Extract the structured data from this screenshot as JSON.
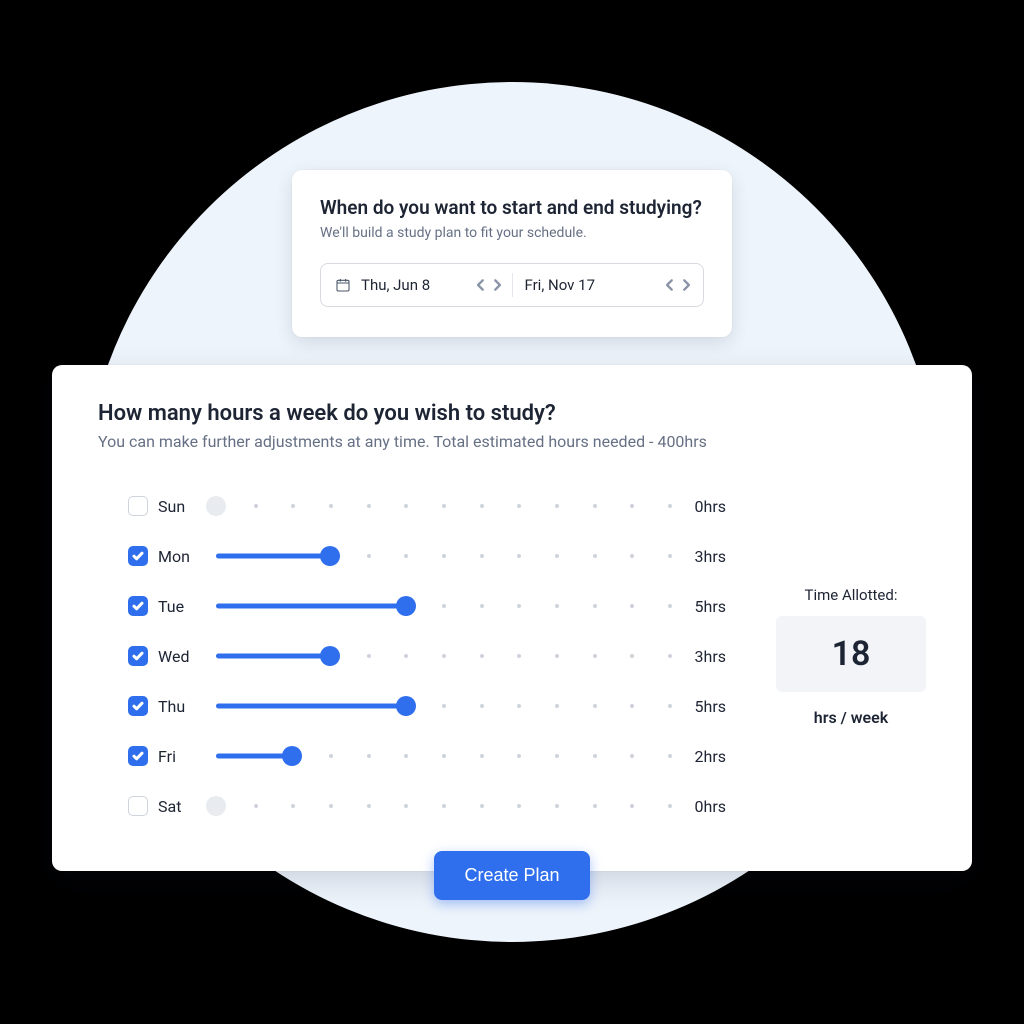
{
  "dateCard": {
    "title": "When do you want to start and end studying?",
    "subtitle": "We'll build a study plan to fit your schedule.",
    "startDate": "Thu, Jun 8",
    "endDate": "Fri, Nov 17"
  },
  "hoursCard": {
    "title": "How many hours a week do you wish to study?",
    "subtitle": "You can make further adjustments at any time. Total estimated hours needed - 400hrs"
  },
  "maxHours": 12,
  "days": [
    {
      "label": "Sun",
      "checked": false,
      "hours": 0
    },
    {
      "label": "Mon",
      "checked": true,
      "hours": 3
    },
    {
      "label": "Tue",
      "checked": true,
      "hours": 5
    },
    {
      "label": "Wed",
      "checked": true,
      "hours": 3
    },
    {
      "label": "Thu",
      "checked": true,
      "hours": 5
    },
    {
      "label": "Fri",
      "checked": true,
      "hours": 2
    },
    {
      "label": "Sat",
      "checked": false,
      "hours": 0
    }
  ],
  "allotted": {
    "label": "Time Allotted:",
    "value": "18",
    "unit": "hrs / week"
  },
  "createButton": "Create Plan"
}
